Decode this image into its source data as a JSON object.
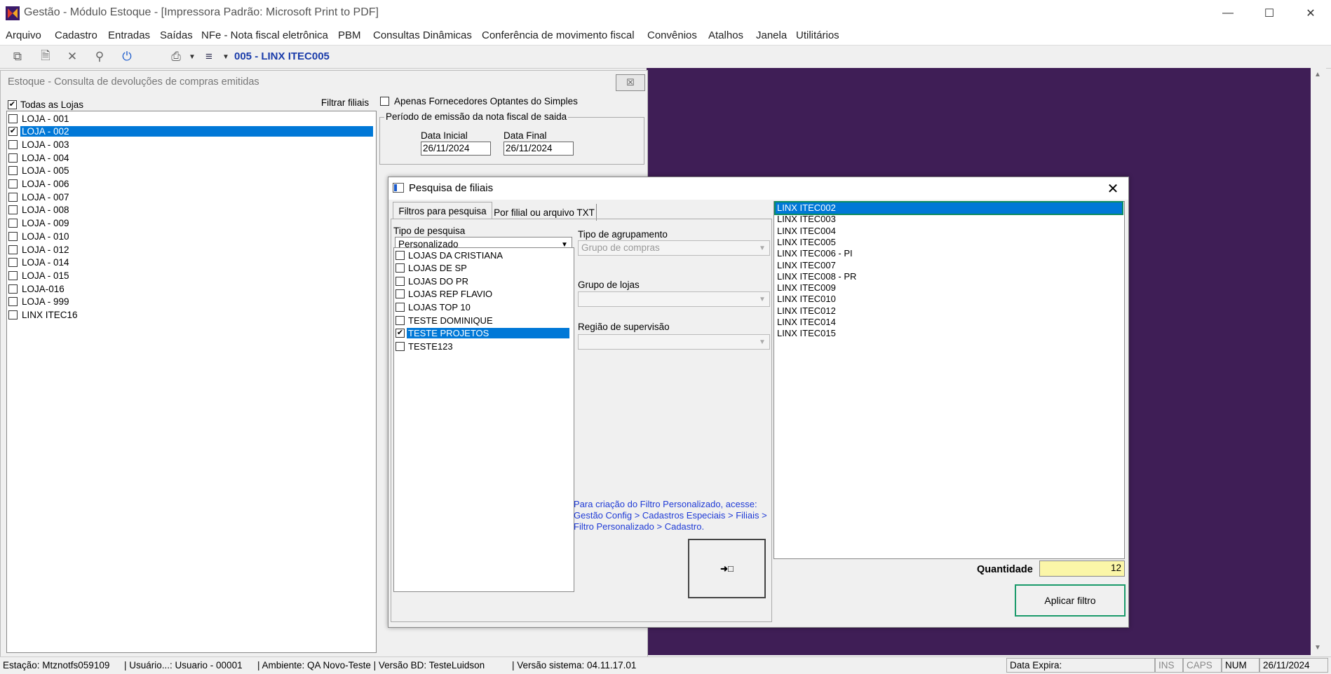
{
  "window": {
    "title": "Gestão  - Módulo Estoque - [Impressora Padrão: Microsoft Print to PDF]",
    "minimize_icon": "minimize-icon",
    "maximize_icon": "maximize-icon",
    "close_icon": "close-icon"
  },
  "menu": [
    "Arquivo",
    "Cadastro",
    "Entradas",
    "Saídas",
    "NFe - Nota fiscal eletrônica",
    "PBM",
    "Consultas Dinâmicas",
    "Conferência de movimento fiscal",
    "Convênios",
    "Atalhos",
    "Janela",
    "Utilitários"
  ],
  "toolbar": {
    "company": "005 - LINX ITEC005",
    "icons": [
      "copy-icon",
      "new-document-icon",
      "delete-icon",
      "search-icon",
      "power-icon",
      "print-icon",
      "dropdown-icon",
      "export-icon",
      "dropdown-icon"
    ]
  },
  "child": {
    "title": "Estoque - Consulta  de devoluções de compras emitidas",
    "todas_lojas": "Todas as Lojas",
    "filtrar_filiais": "Filtrar filiais",
    "apenas_fornecedores": "Apenas Fornecedores Optantes do Simples",
    "periodo_label": "Período de emissão da nota fiscal de saida",
    "data_inicial_label": "Data Inicial",
    "data_inicial": "26/11/2024",
    "data_final_label": "Data Final",
    "data_final": "26/11/2024",
    "lojas": [
      {
        "label": "LOJA - 001",
        "checked": false,
        "selected": false
      },
      {
        "label": "LOJA - 002",
        "checked": true,
        "selected": true
      },
      {
        "label": "LOJA - 003",
        "checked": false,
        "selected": false
      },
      {
        "label": "LOJA - 004",
        "checked": false,
        "selected": false
      },
      {
        "label": "LOJA - 005",
        "checked": false,
        "selected": false
      },
      {
        "label": "LOJA - 006",
        "checked": false,
        "selected": false
      },
      {
        "label": "LOJA - 007",
        "checked": false,
        "selected": false
      },
      {
        "label": "LOJA - 008",
        "checked": false,
        "selected": false
      },
      {
        "label": "LOJA - 009",
        "checked": false,
        "selected": false
      },
      {
        "label": "LOJA - 010",
        "checked": false,
        "selected": false
      },
      {
        "label": "LOJA - 012",
        "checked": false,
        "selected": false
      },
      {
        "label": "LOJA - 014",
        "checked": false,
        "selected": false
      },
      {
        "label": "LOJA - 015",
        "checked": false,
        "selected": false
      },
      {
        "label": "LOJA-016",
        "checked": false,
        "selected": false
      },
      {
        "label": "LOJA - 999",
        "checked": false,
        "selected": false
      },
      {
        "label": "LINX ITEC16",
        "checked": false,
        "selected": false
      }
    ]
  },
  "dialog": {
    "title": "Pesquisa de filiais",
    "tab1": "Filtros para pesquisa",
    "tab2": "Por filial ou arquivo TXT",
    "tipo_pesquisa_label": "Tipo de pesquisa",
    "tipo_pesquisa_value": "Personalizado",
    "tipo_agrupamento_label": "Tipo de agrupamento",
    "tipo_agrupamento_value": "Grupo de compras",
    "grupo_lojas_label": "Grupo de lojas",
    "grupo_lojas_value": "",
    "regiao_label": "Região de supervisão",
    "regiao_value": "",
    "grupos": [
      {
        "label": "LOJAS DA CRISTIANA",
        "checked": false,
        "selected": false
      },
      {
        "label": "LOJAS DE SP",
        "checked": false,
        "selected": false
      },
      {
        "label": "LOJAS DO PR",
        "checked": false,
        "selected": false
      },
      {
        "label": "LOJAS REP FLAVIO",
        "checked": false,
        "selected": false
      },
      {
        "label": "LOJAS TOP 10",
        "checked": false,
        "selected": false
      },
      {
        "label": "TESTE DOMINIQUE",
        "checked": false,
        "selected": false
      },
      {
        "label": "TESTE PROJETOS",
        "checked": true,
        "selected": true
      },
      {
        "label": "TESTE123",
        "checked": false,
        "selected": false
      }
    ],
    "info": "Para criação do Filtro Personalizado, acesse: Gestão Config > Cadastros Especiais > Filiais > Filtro Personalizado > Cadastro.",
    "transfer_icon": "transfer-icon",
    "filiais": [
      "LINX ITEC002",
      "LINX ITEC003",
      "LINX ITEC004",
      "LINX ITEC005",
      "LINX ITEC006 - PI",
      "LINX ITEC007",
      "LINX ITEC008 - PR",
      "LINX ITEC009",
      "LINX ITEC010",
      "LINX ITEC012",
      "LINX ITEC014",
      "LINX ITEC015"
    ],
    "quantidade_label": "Quantidade",
    "quantidade": "12",
    "aplicar": "Aplicar filtro"
  },
  "status": {
    "estacao": "Estação: Mtznotfs059109",
    "usuario": "| Usuário...: Usuario - 00001",
    "ambiente": "| Ambiente: QA Novo-Teste | Versão BD: TesteLuidson",
    "versao": "| Versão sistema: 04.11.17.01",
    "data_expira": "Data Expira:",
    "ins": "INS",
    "caps": "CAPS",
    "num": "NUM",
    "data": "26/11/2024"
  }
}
